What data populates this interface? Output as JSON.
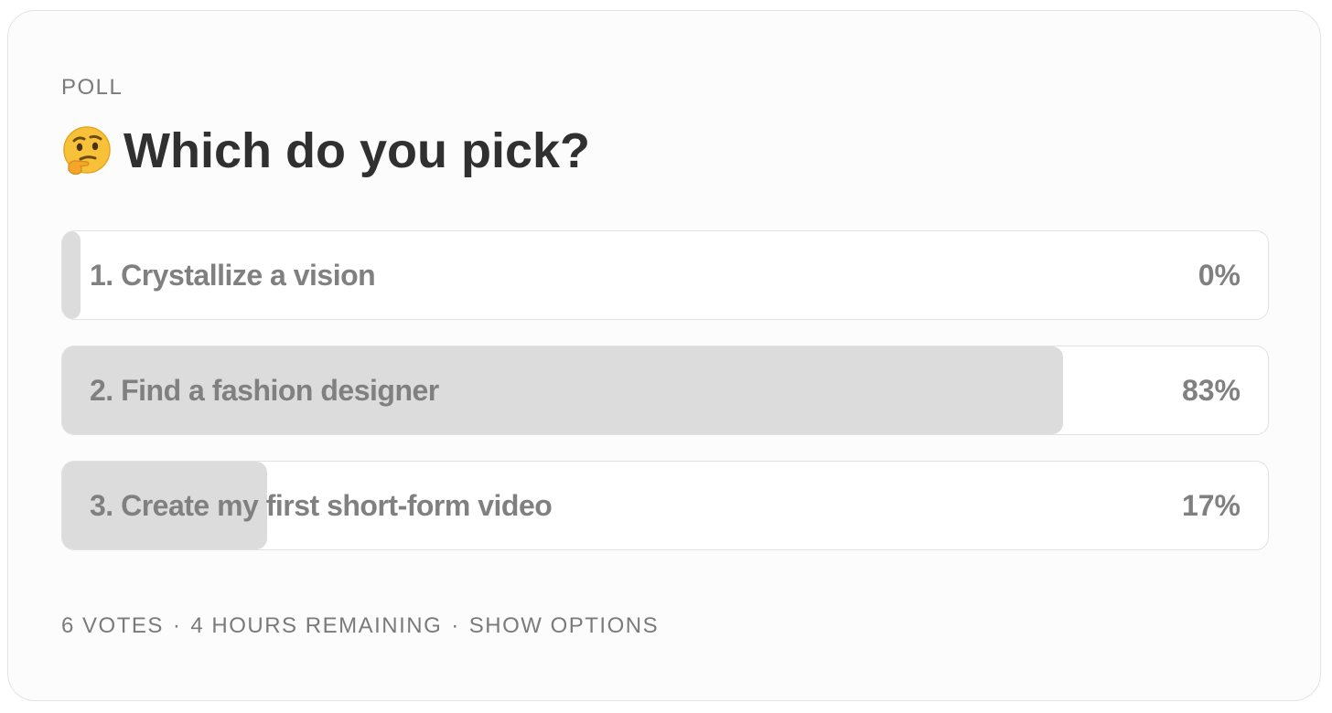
{
  "poll": {
    "label": "POLL",
    "title": "Which do you pick?",
    "title_icon": "thinking-face-icon",
    "options": [
      {
        "label": "1. Crystallize a vision",
        "percent": "0%",
        "fill_fraction": 0.0
      },
      {
        "label": "2. Find a fashion designer",
        "percent": "83%",
        "fill_fraction": 0.83
      },
      {
        "label": "3. Create my first short-form video",
        "percent": "17%",
        "fill_fraction": 0.17
      }
    ],
    "footer": {
      "votes": "6 VOTES",
      "separator": "·",
      "remaining": "4 HOURS REMAINING",
      "show_options": "SHOW OPTIONS"
    }
  },
  "colors": {
    "card_background": "#fcfcfc",
    "fill": "#dcdcdc",
    "text_muted": "#808080",
    "title_text": "#303030"
  }
}
